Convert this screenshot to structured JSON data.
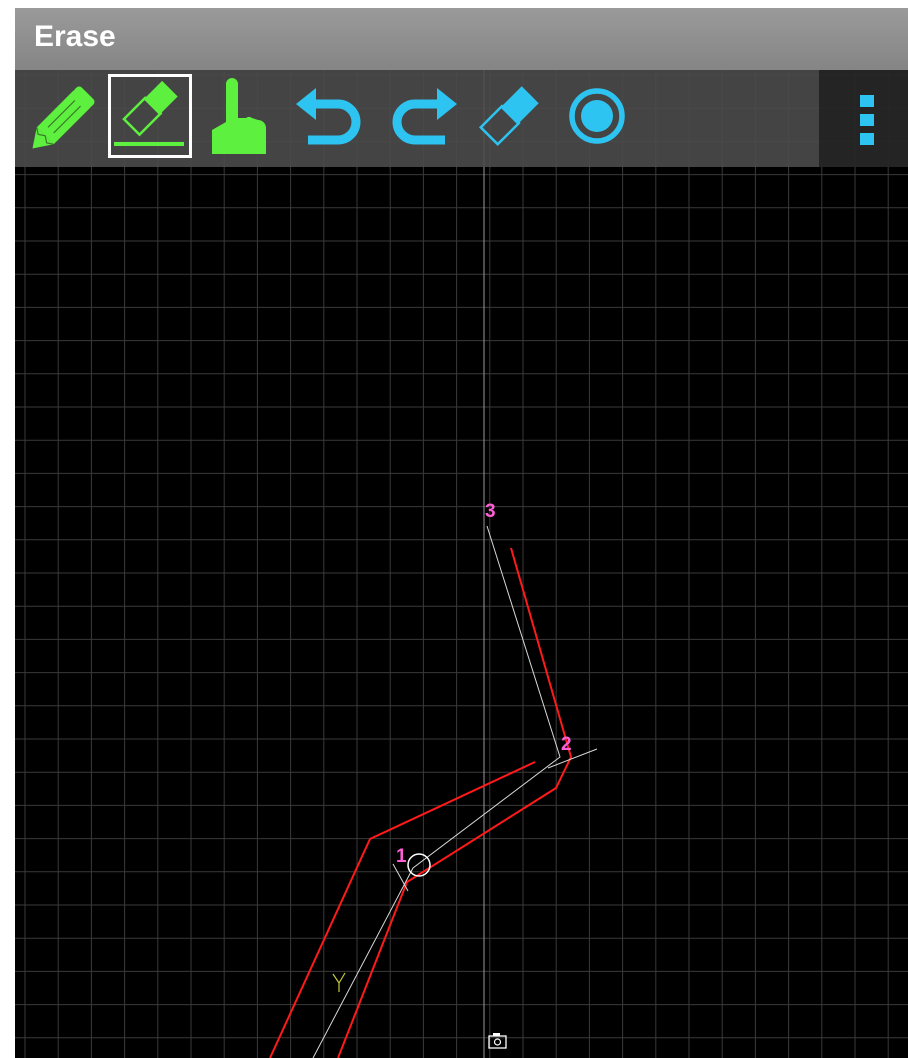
{
  "window": {
    "title": "Erase"
  },
  "toolbar": {
    "tools": [
      {
        "name": "pencil",
        "icon": "pencil-icon",
        "color": "#5ef03f",
        "selected": false
      },
      {
        "name": "erase",
        "icon": "eraser-underline-icon",
        "color": "#5ef03f",
        "selected": true
      },
      {
        "name": "pointer",
        "icon": "hand-pointer-icon",
        "color": "#5ef03f",
        "selected": false
      },
      {
        "name": "undo",
        "icon": "undo-icon",
        "color": "#2ec4f2",
        "selected": false
      },
      {
        "name": "redo",
        "icon": "redo-icon",
        "color": "#2ec4f2",
        "selected": false
      },
      {
        "name": "erase-all",
        "icon": "eraser-icon",
        "color": "#2ec4f2",
        "selected": false
      },
      {
        "name": "record",
        "icon": "record-icon",
        "color": "#2ec4f2",
        "selected": false
      }
    ],
    "overflow_icon": "more-vert-icon"
  },
  "canvas": {
    "background": "#000000",
    "grid_color": "#3a3a3a",
    "axis_color": "#9a9a9a",
    "path_color": "#ffffff",
    "outline_color": "#ff1a1a",
    "label_color": "#ff5fd4",
    "points": [
      {
        "label": "1"
      },
      {
        "label": "2"
      },
      {
        "label": "3"
      }
    ],
    "camera_icon": "camera-icon"
  }
}
